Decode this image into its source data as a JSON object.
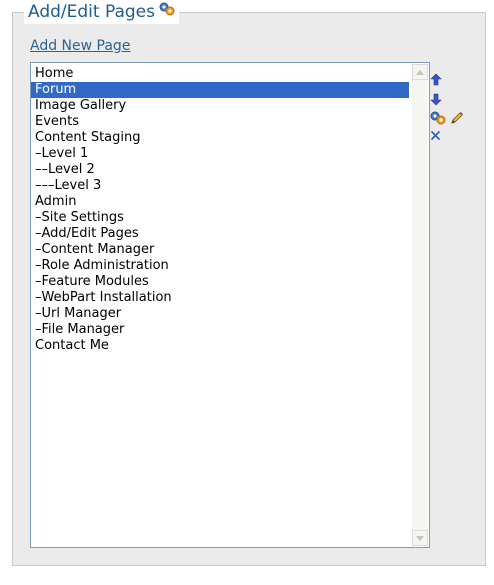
{
  "header": {
    "title": "Add/Edit Pages",
    "icon": "gear-icon"
  },
  "add_link": {
    "label": "Add New Page"
  },
  "pages": [
    "Home",
    "Forum",
    "Image Gallery",
    "Events",
    "Content Staging",
    "–Level 1",
    "––Level 2",
    "–––Level 3",
    "Admin",
    "–Site Settings",
    "–Add/Edit Pages",
    "–Content Manager",
    "–Role Administration",
    "–Feature Modules",
    "–WebPart Installation",
    "–Url Manager",
    "–File Manager",
    "Contact Me"
  ],
  "selected_page": "Forum",
  "toolbar": {
    "move_up": "arrow-up-icon",
    "move_down": "arrow-down-icon",
    "settings": "gear-icon",
    "edit": "pencil-icon",
    "delete": "delete-x-icon"
  },
  "colors": {
    "title": "#1f5b8f",
    "link": "#2a6496",
    "selection": "#316ac5",
    "panel": "#ebebeb",
    "arrow": "#3a55c8"
  }
}
